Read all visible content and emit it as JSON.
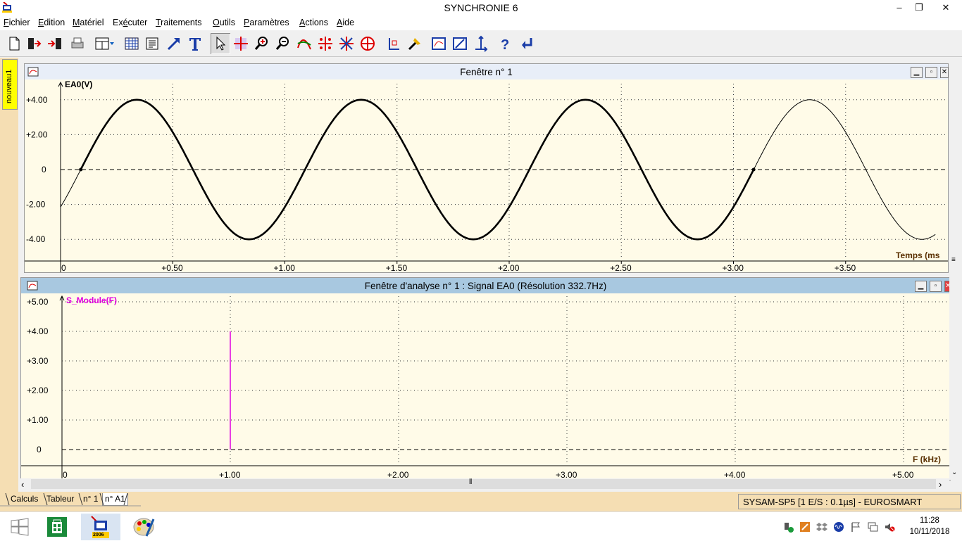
{
  "app": {
    "title": "SYNCHRONIE 6"
  },
  "window_controls": {
    "minimize": "‒",
    "maximize": "❐",
    "close": "✕"
  },
  "menu": [
    {
      "label": "Fichier",
      "underline": "F",
      "rest": "ichier"
    },
    {
      "label": "Edition",
      "underline": "E",
      "rest": "dition"
    },
    {
      "label": "Matériel",
      "underline": "M",
      "rest": "atériel"
    },
    {
      "label": "Exécuter",
      "pre": "Ex",
      "underline": "é",
      "rest": "cuter"
    },
    {
      "label": "Traitements",
      "underline": "T",
      "rest": "raitements"
    },
    {
      "label": "Outils",
      "underline": "O",
      "rest": "utils"
    },
    {
      "label": "Paramètres",
      "underline": "P",
      "rest": "aramètres"
    },
    {
      "label": "Actions",
      "underline": "A",
      "rest": "ctions"
    },
    {
      "label": "Aide",
      "underline": "A",
      "rest": "ide"
    }
  ],
  "toolbar": {
    "icons": [
      "new-document-icon",
      "open-file-icon",
      "save-file-icon",
      "print-icon",
      "window-layout-icon",
      "table-icon",
      "notepad-icon",
      "arrow-icon",
      "text-tool-icon",
      "pointer-icon",
      "cursor-cross-icon",
      "zoom-in-icon",
      "zoom-out-icon",
      "curve-modeling-icon",
      "crosshair-points-icon",
      "delete-points-icon",
      "target-icon",
      "axis-icon",
      "marker-icon",
      "graph-window-icon",
      "graph-edit-icon",
      "axis-arrows-icon",
      "help-icon",
      "return-arrow-icon"
    ]
  },
  "side_tab": {
    "label": "nouveau1"
  },
  "window1": {
    "title": "Fenêtre n° 1",
    "y_label": "EA0(V)",
    "x_label": "Temps (ms",
    "y_ticks": [
      "+4.00",
      "+2.00",
      "0",
      "-2.00",
      "-4.00"
    ],
    "x_ticks": [
      "0",
      "+0.50",
      "+1.00",
      "+1.50",
      "+2.00",
      "+2.50",
      "+3.00",
      "+3.50"
    ]
  },
  "window2": {
    "title": "Fenêtre d'analyse n° 1 :  Signal EA0   (Résolution 332.7Hz)",
    "y_label": "S_Module(F)",
    "x_label": "F (kHz)",
    "y_ticks": [
      "+5.00",
      "+4.00",
      "+3.00",
      "+2.00",
      "+1.00",
      "0"
    ],
    "x_ticks": [
      "0",
      "+1.00",
      "+2.00",
      "+3.00",
      "+4.00",
      "+5.00"
    ]
  },
  "chart_data": [
    {
      "type": "line",
      "xlabel": "Temps (ms",
      "ylabel": "EA0(V)",
      "xlim": [
        0,
        3.9
      ],
      "ylim": [
        -4.8,
        4.8
      ],
      "grid": true,
      "series": [
        {
          "amplitude": 4.0,
          "frequency_khz": 1.0,
          "x": [
            0,
            0.09,
            0.34,
            0.84,
            1.34,
            1.84,
            2.34,
            2.84,
            3.09,
            3.34,
            3.84
          ],
          "y": [
            -2.2,
            0,
            4.0,
            -4.0,
            4.0,
            -4.0,
            4.0,
            -4.0,
            0,
            4.0,
            -4.0
          ]
        }
      ],
      "bold_segment_x": [
        0.09,
        3.09
      ]
    },
    {
      "type": "bar",
      "xlabel": "F (kHz)",
      "ylabel": "S_Module(F)",
      "xlim": [
        0,
        5.0
      ],
      "ylim": [
        -0.5,
        5.2
      ],
      "grid": true,
      "series": [
        {
          "name": "S_Module(F)",
          "x": [
            1.0
          ],
          "values": [
            4.0
          ]
        }
      ],
      "color": "#e000e0"
    }
  ],
  "bottom_tabs": [
    "Calculs",
    "Tableur",
    "n° 1",
    "n° A1"
  ],
  "status": "SYSAM-SP5 [1 E/S : 0.1µs] - EUROSMART",
  "taskbar": {
    "badge": "2006",
    "time": "11:28",
    "date": "10/11/2018"
  },
  "colors": {
    "plot_bg": "#fffbe8",
    "window2_title_bg": "#a8c8e0",
    "window1_title_bg": "#e6eef8",
    "spectrum": "#e000e0",
    "side_strip": "#f5deb3"
  }
}
